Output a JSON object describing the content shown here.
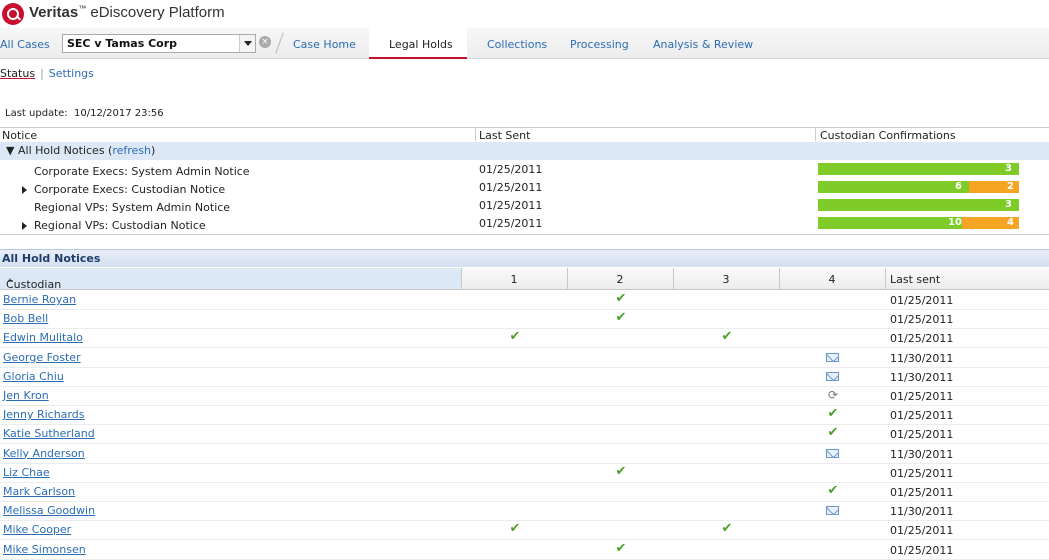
{
  "brand": {
    "name_bold": "Veritas",
    "tm": "™",
    "name_rest": " eDiscovery Platform"
  },
  "nav": {
    "all_cases": "All Cases",
    "case_value": "SEC v Tamas Corp",
    "tabs": [
      {
        "label": "Case Home",
        "active": false
      },
      {
        "label": "Legal Holds",
        "active": true
      },
      {
        "label": "Collections",
        "active": false
      },
      {
        "label": "Processing",
        "active": false
      },
      {
        "label": "Analysis & Review",
        "active": false
      }
    ]
  },
  "subtabs": {
    "status": "Status",
    "settings": "Settings"
  },
  "last_update": {
    "label": "Last update:",
    "value": "10/12/2017 23:56"
  },
  "notices": {
    "headers": {
      "notice": "Notice",
      "last_sent": "Last Sent",
      "confirmations": "Custodian Confirmations"
    },
    "group_label": "All Hold Notices (",
    "refresh": "refresh",
    "group_close": ")",
    "rows": [
      {
        "name": "Corporate Execs: System Admin Notice",
        "expandable": false,
        "date": "01/25/2011",
        "confirmed": 3,
        "pending": 0,
        "confirmed_label": "3",
        "pending_label": ""
      },
      {
        "name": "Corporate Execs: Custodian Notice",
        "expandable": true,
        "date": "01/25/2011",
        "confirmed": 6,
        "pending": 2,
        "confirmed_label": "6",
        "pending_label": "2"
      },
      {
        "name": "Regional VPs: System Admin Notice",
        "expandable": false,
        "date": "01/25/2011",
        "confirmed": 3,
        "pending": 0,
        "confirmed_label": "3",
        "pending_label": ""
      },
      {
        "name": "Regional VPs: Custodian Notice",
        "expandable": true,
        "date": "01/25/2011",
        "confirmed": 10,
        "pending": 4,
        "confirmed_label": "10",
        "pending_label": "4"
      }
    ]
  },
  "custodians": {
    "title": "All Hold Notices",
    "headers": {
      "custodian": "Custodian",
      "c1": "1",
      "c2": "2",
      "c3": "3",
      "c4": "4",
      "last_sent": "Last sent"
    },
    "rows": [
      {
        "name": "Bernie Royan",
        "s1": "",
        "s2": "check",
        "s3": "",
        "s4": "",
        "last": "01/25/2011"
      },
      {
        "name": "Bob Bell",
        "s1": "",
        "s2": "check",
        "s3": "",
        "s4": "",
        "last": "01/25/2011"
      },
      {
        "name": "Edwin Mulitalo",
        "s1": "check",
        "s2": "",
        "s3": "check",
        "s4": "",
        "last": "01/25/2011"
      },
      {
        "name": "George Foster",
        "s1": "",
        "s2": "",
        "s3": "",
        "s4": "mail",
        "last": "11/30/2011"
      },
      {
        "name": "Gloria Chiu",
        "s1": "",
        "s2": "",
        "s3": "",
        "s4": "mail",
        "last": "11/30/2011"
      },
      {
        "name": "Jen Kron",
        "s1": "",
        "s2": "",
        "s3": "",
        "s4": "sync",
        "last": "01/25/2011"
      },
      {
        "name": "Jenny Richards",
        "s1": "",
        "s2": "",
        "s3": "",
        "s4": "check",
        "last": "01/25/2011"
      },
      {
        "name": "Katie Sutherland",
        "s1": "",
        "s2": "",
        "s3": "",
        "s4": "check",
        "last": "01/25/2011"
      },
      {
        "name": "Kelly Anderson",
        "s1": "",
        "s2": "",
        "s3": "",
        "s4": "mail",
        "last": "11/30/2011"
      },
      {
        "name": "Liz Chae",
        "s1": "",
        "s2": "check",
        "s3": "",
        "s4": "",
        "last": "01/25/2011"
      },
      {
        "name": "Mark Carlson",
        "s1": "",
        "s2": "",
        "s3": "",
        "s4": "check",
        "last": "01/25/2011"
      },
      {
        "name": "Melissa Goodwin",
        "s1": "",
        "s2": "",
        "s3": "",
        "s4": "mail",
        "last": "11/30/2011"
      },
      {
        "name": "Mike Cooper",
        "s1": "check",
        "s2": "",
        "s3": "check",
        "s4": "",
        "last": "01/25/2011"
      },
      {
        "name": "Mike Simonsen",
        "s1": "",
        "s2": "check",
        "s3": "",
        "s4": "",
        "last": "01/25/2011"
      }
    ]
  },
  "colors": {
    "confirmed": "#7fcc28",
    "pending": "#f5a522",
    "link": "#2b6cb5",
    "accent": "#c8102e"
  }
}
